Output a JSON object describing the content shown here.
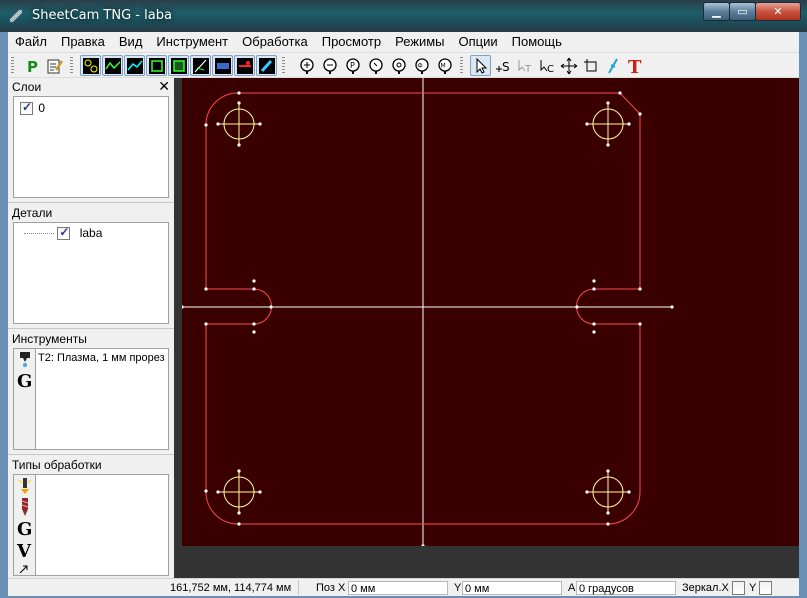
{
  "window": {
    "title": "SheetCam TNG - laba"
  },
  "menu": [
    "Файл",
    "Правка",
    "Вид",
    "Инструмент",
    "Обработка",
    "Просмотр",
    "Режимы",
    "Опции",
    "Помощь"
  ],
  "toolbar_icons": [
    "run-post-processor-icon",
    "edit-code-icon",
    "view-parts-icon",
    "view-paths-icon",
    "view-rapids-icon",
    "view-outline-icon",
    "view-filled-icon",
    "view-lead-icon",
    "view-toolbar-icon",
    "view-red-icon",
    "view-brush-icon",
    "zoom-in-icon",
    "zoom-out-icon",
    "zoom-part-icon",
    "zoom-window-icon",
    "zoom-all-icon",
    "zoom-operation-icon",
    "zoom-mode-icon",
    "select-icon",
    "start-point-icon",
    "text-select-icon",
    "node-select-icon",
    "move-icon",
    "rotate-icon",
    "dimension-icon",
    "text-tool-icon"
  ],
  "panels": {
    "layers": {
      "title": "Слои",
      "items": [
        {
          "label": "0",
          "checked": true
        }
      ]
    },
    "parts": {
      "title": "Детали",
      "items": [
        {
          "label": "laba",
          "checked": true
        }
      ]
    },
    "tools": {
      "title": "Инструменты",
      "items": [
        {
          "label": "T2: Плазма, 1 мм прорез"
        }
      ]
    },
    "operations": {
      "title": "Типы обработки"
    }
  },
  "status": {
    "coords": "161,752 мм, 114,774 мм",
    "pos_x_label": "Поз X",
    "pos_x_value": "0 мм",
    "y_label": "Y",
    "y_value": "0 мм",
    "a_label": "A",
    "a_value": "0 градусов",
    "mirror_x_label": "Зеркал.X",
    "mirror_y_label": "Y"
  },
  "colors": {
    "canvas_bg": "#3a0000",
    "part_outline": "#ff4a4a",
    "holes": "#ffff99",
    "crosshair": "#ffffff"
  }
}
